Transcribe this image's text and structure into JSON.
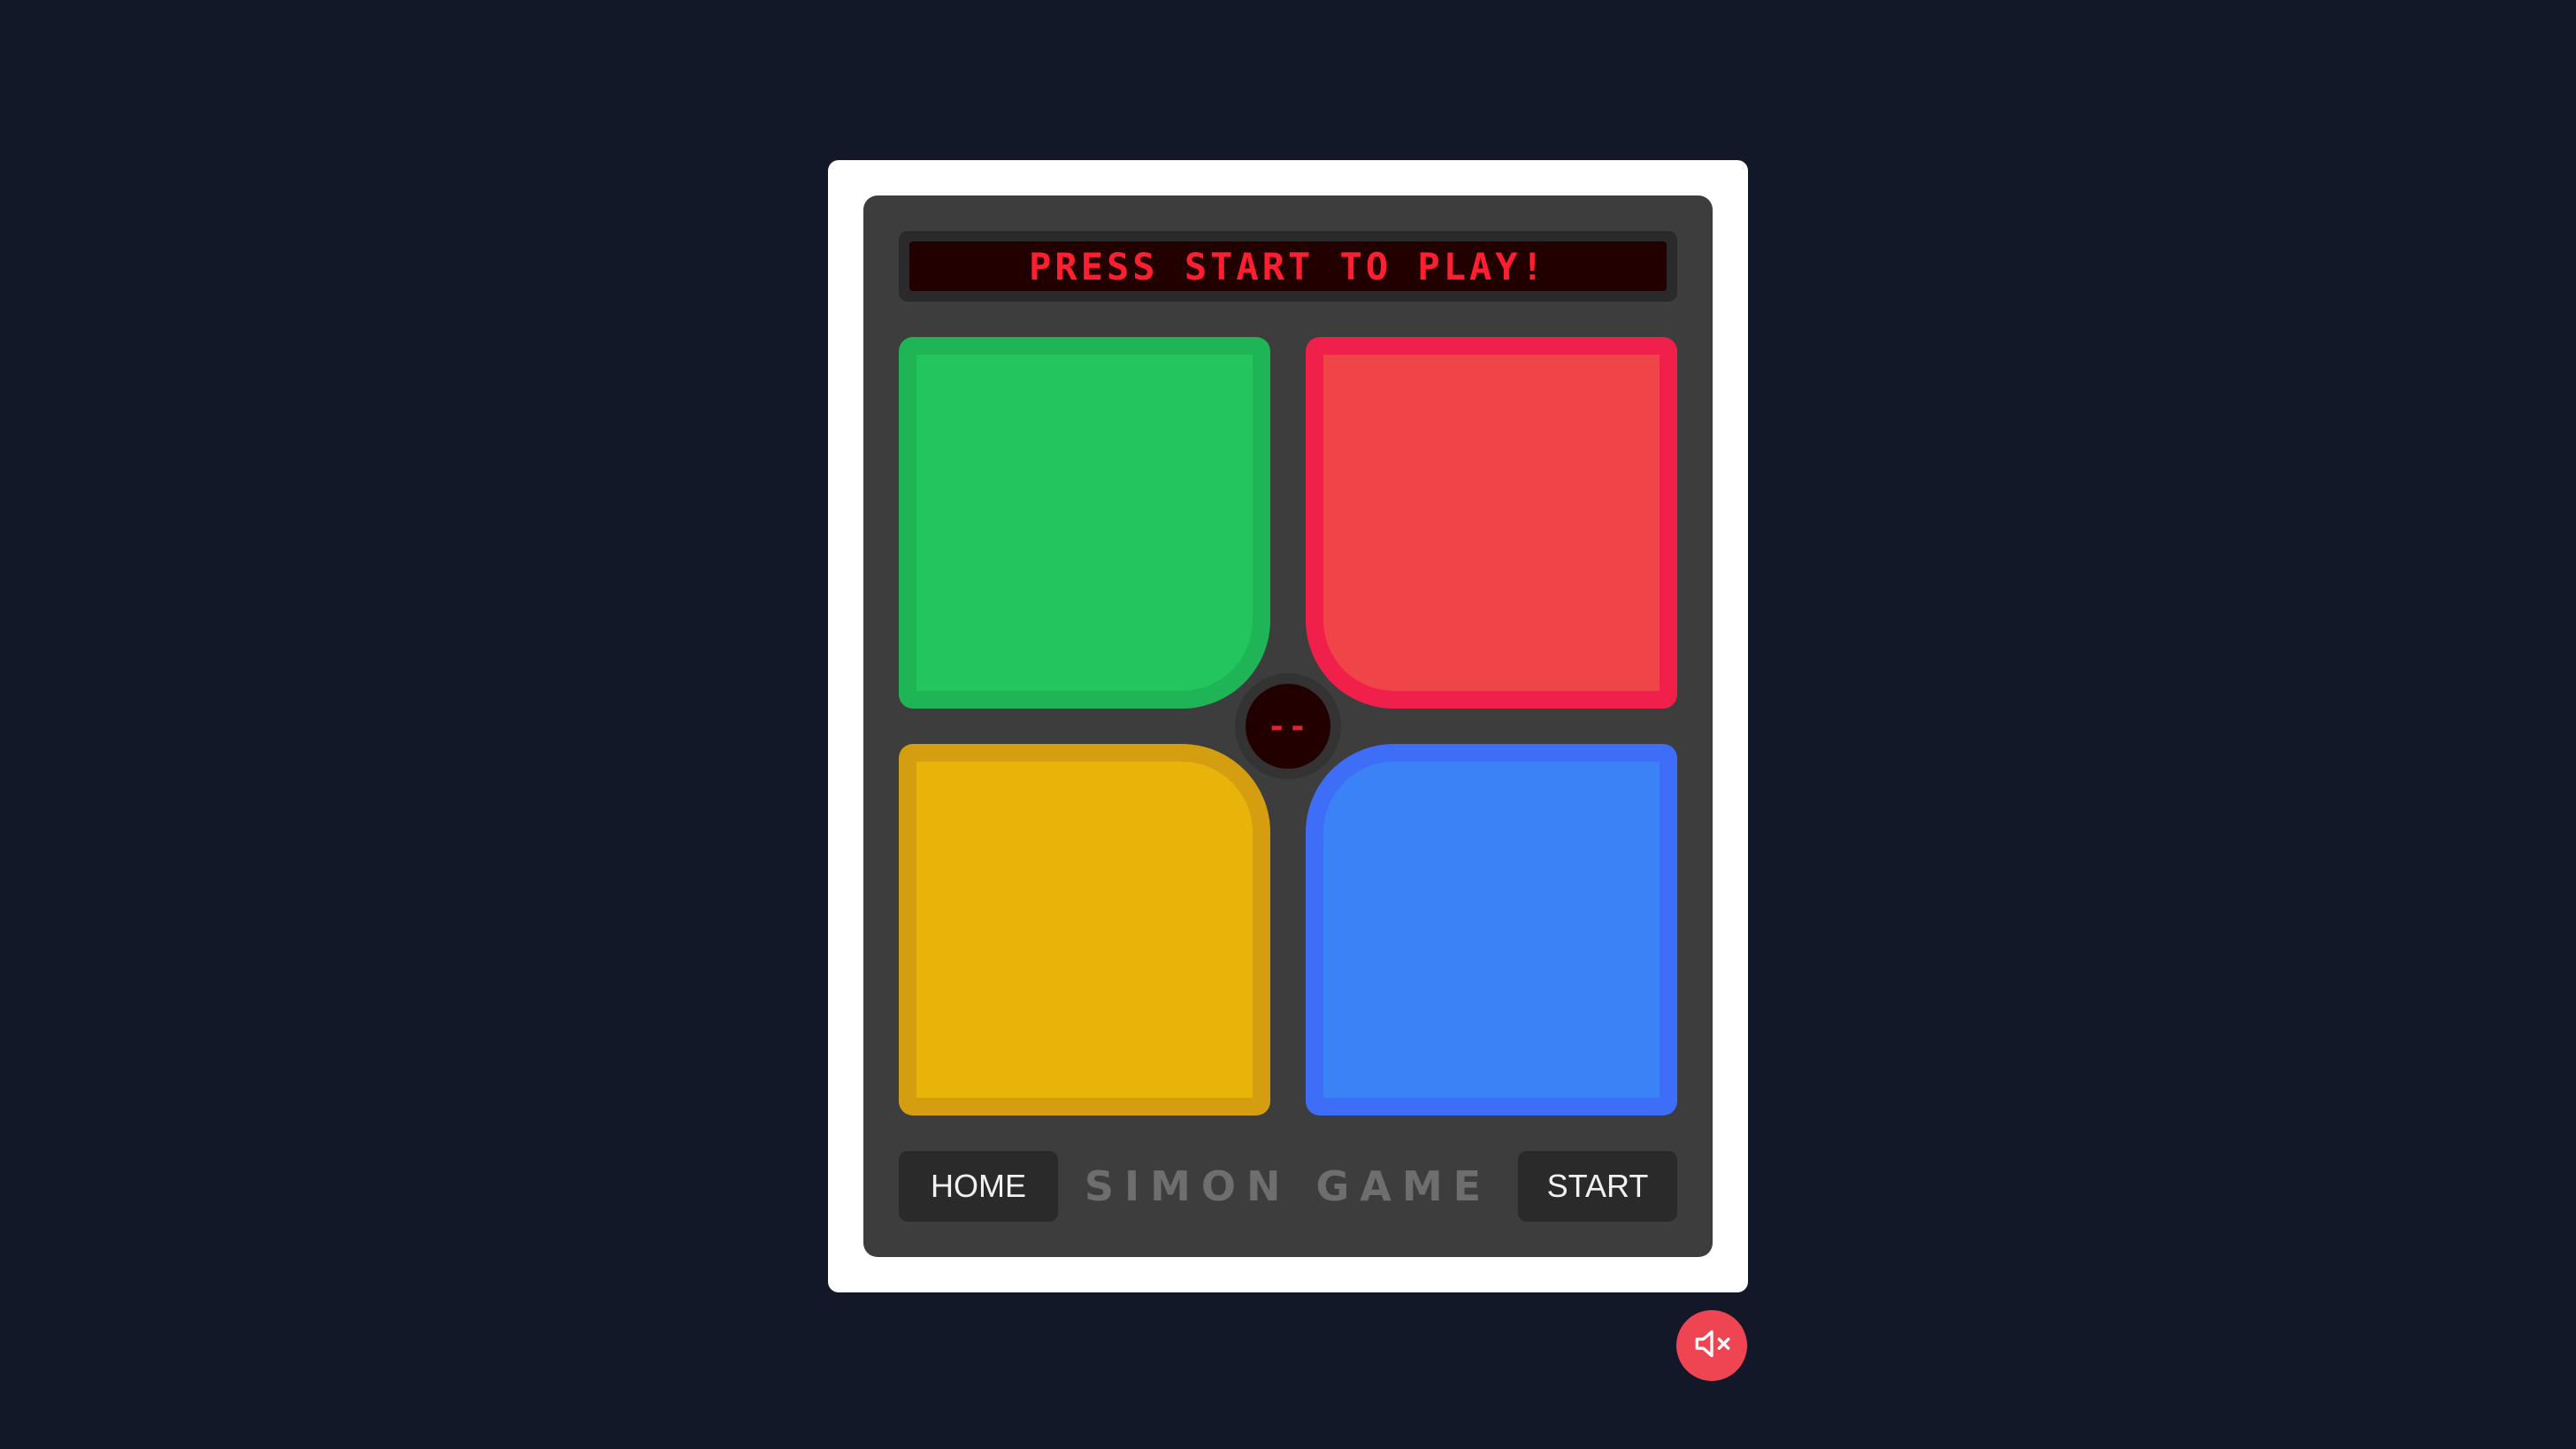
{
  "display": {
    "message": "PRESS START TO PLAY!",
    "counter": "--"
  },
  "pads": [
    {
      "name": "green",
      "color": "#22c55e"
    },
    {
      "name": "red",
      "color": "#ef4448"
    },
    {
      "name": "yellow",
      "color": "#e8b40a"
    },
    {
      "name": "blue",
      "color": "#3b82f6"
    }
  ],
  "controls": {
    "home_label": "HOME",
    "start_label": "START",
    "brand": "SIMON GAME"
  },
  "sound": {
    "icon": "speaker-muted-icon",
    "muted": true
  },
  "colors": {
    "background": "#121828",
    "console": "#3d3d3d",
    "display_text": "#ff1f2f",
    "mute_button": "#ef4452"
  }
}
